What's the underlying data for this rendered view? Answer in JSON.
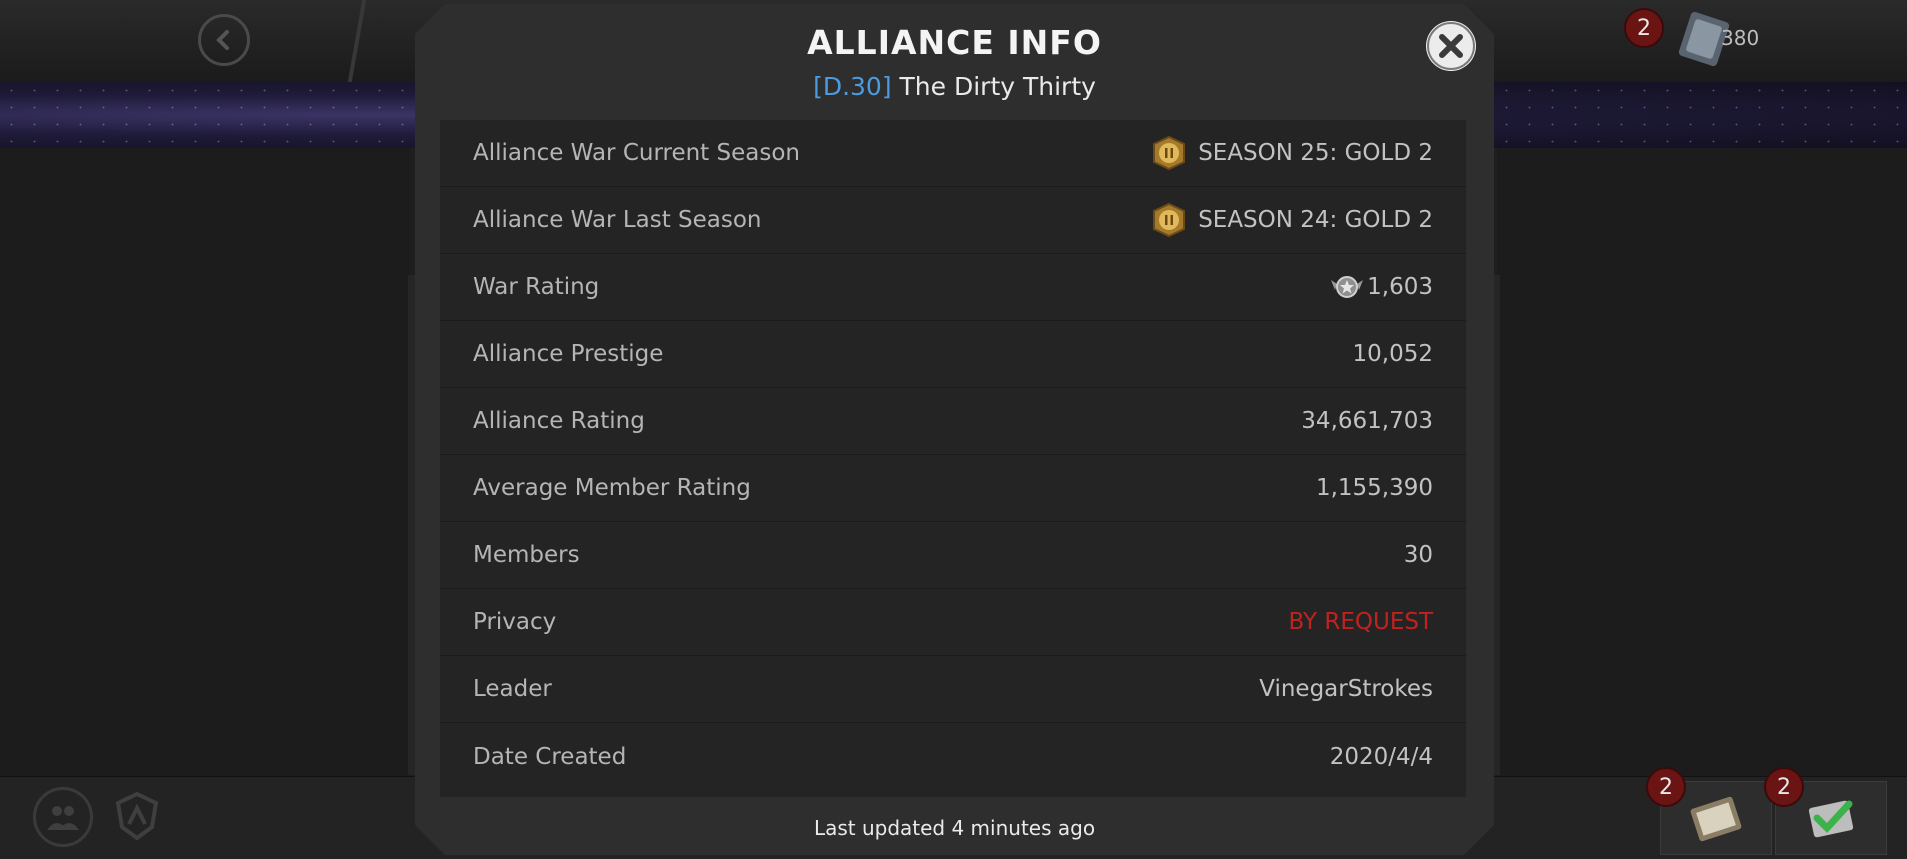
{
  "background": {
    "currency": {
      "badge_count": "2",
      "value": "380"
    },
    "bottom_tools": [
      {
        "name": "quests",
        "badge_count": "2"
      },
      {
        "name": "checklist",
        "badge_count": "2"
      }
    ]
  },
  "modal": {
    "title": "ALLIANCE INFO",
    "tag": "[D.30]",
    "alliance_name": "The Dirty Thirty",
    "footer": "Last updated 4 minutes ago"
  },
  "rows": [
    {
      "label": "Alliance War Current Season",
      "value": "SEASON 25: GOLD 2",
      "icon": "gold-tier-badge-icon"
    },
    {
      "label": "Alliance War Last Season",
      "value": "SEASON 24: GOLD 2",
      "icon": "gold-tier-badge-icon"
    },
    {
      "label": "War Rating",
      "value": "1,603",
      "icon": "war-rating-icon"
    },
    {
      "label": "Alliance Prestige",
      "value": "10,052"
    },
    {
      "label": "Alliance Rating",
      "value": "34,661,703"
    },
    {
      "label": "Average Member Rating",
      "value": "1,155,390"
    },
    {
      "label": "Members",
      "value": "30"
    },
    {
      "label": "Privacy",
      "value": "BY REQUEST",
      "color": "#c0221f"
    },
    {
      "label": "Leader",
      "value": "VinegarStrokes"
    },
    {
      "label": "Date Created",
      "value": "2020/4/4"
    }
  ]
}
